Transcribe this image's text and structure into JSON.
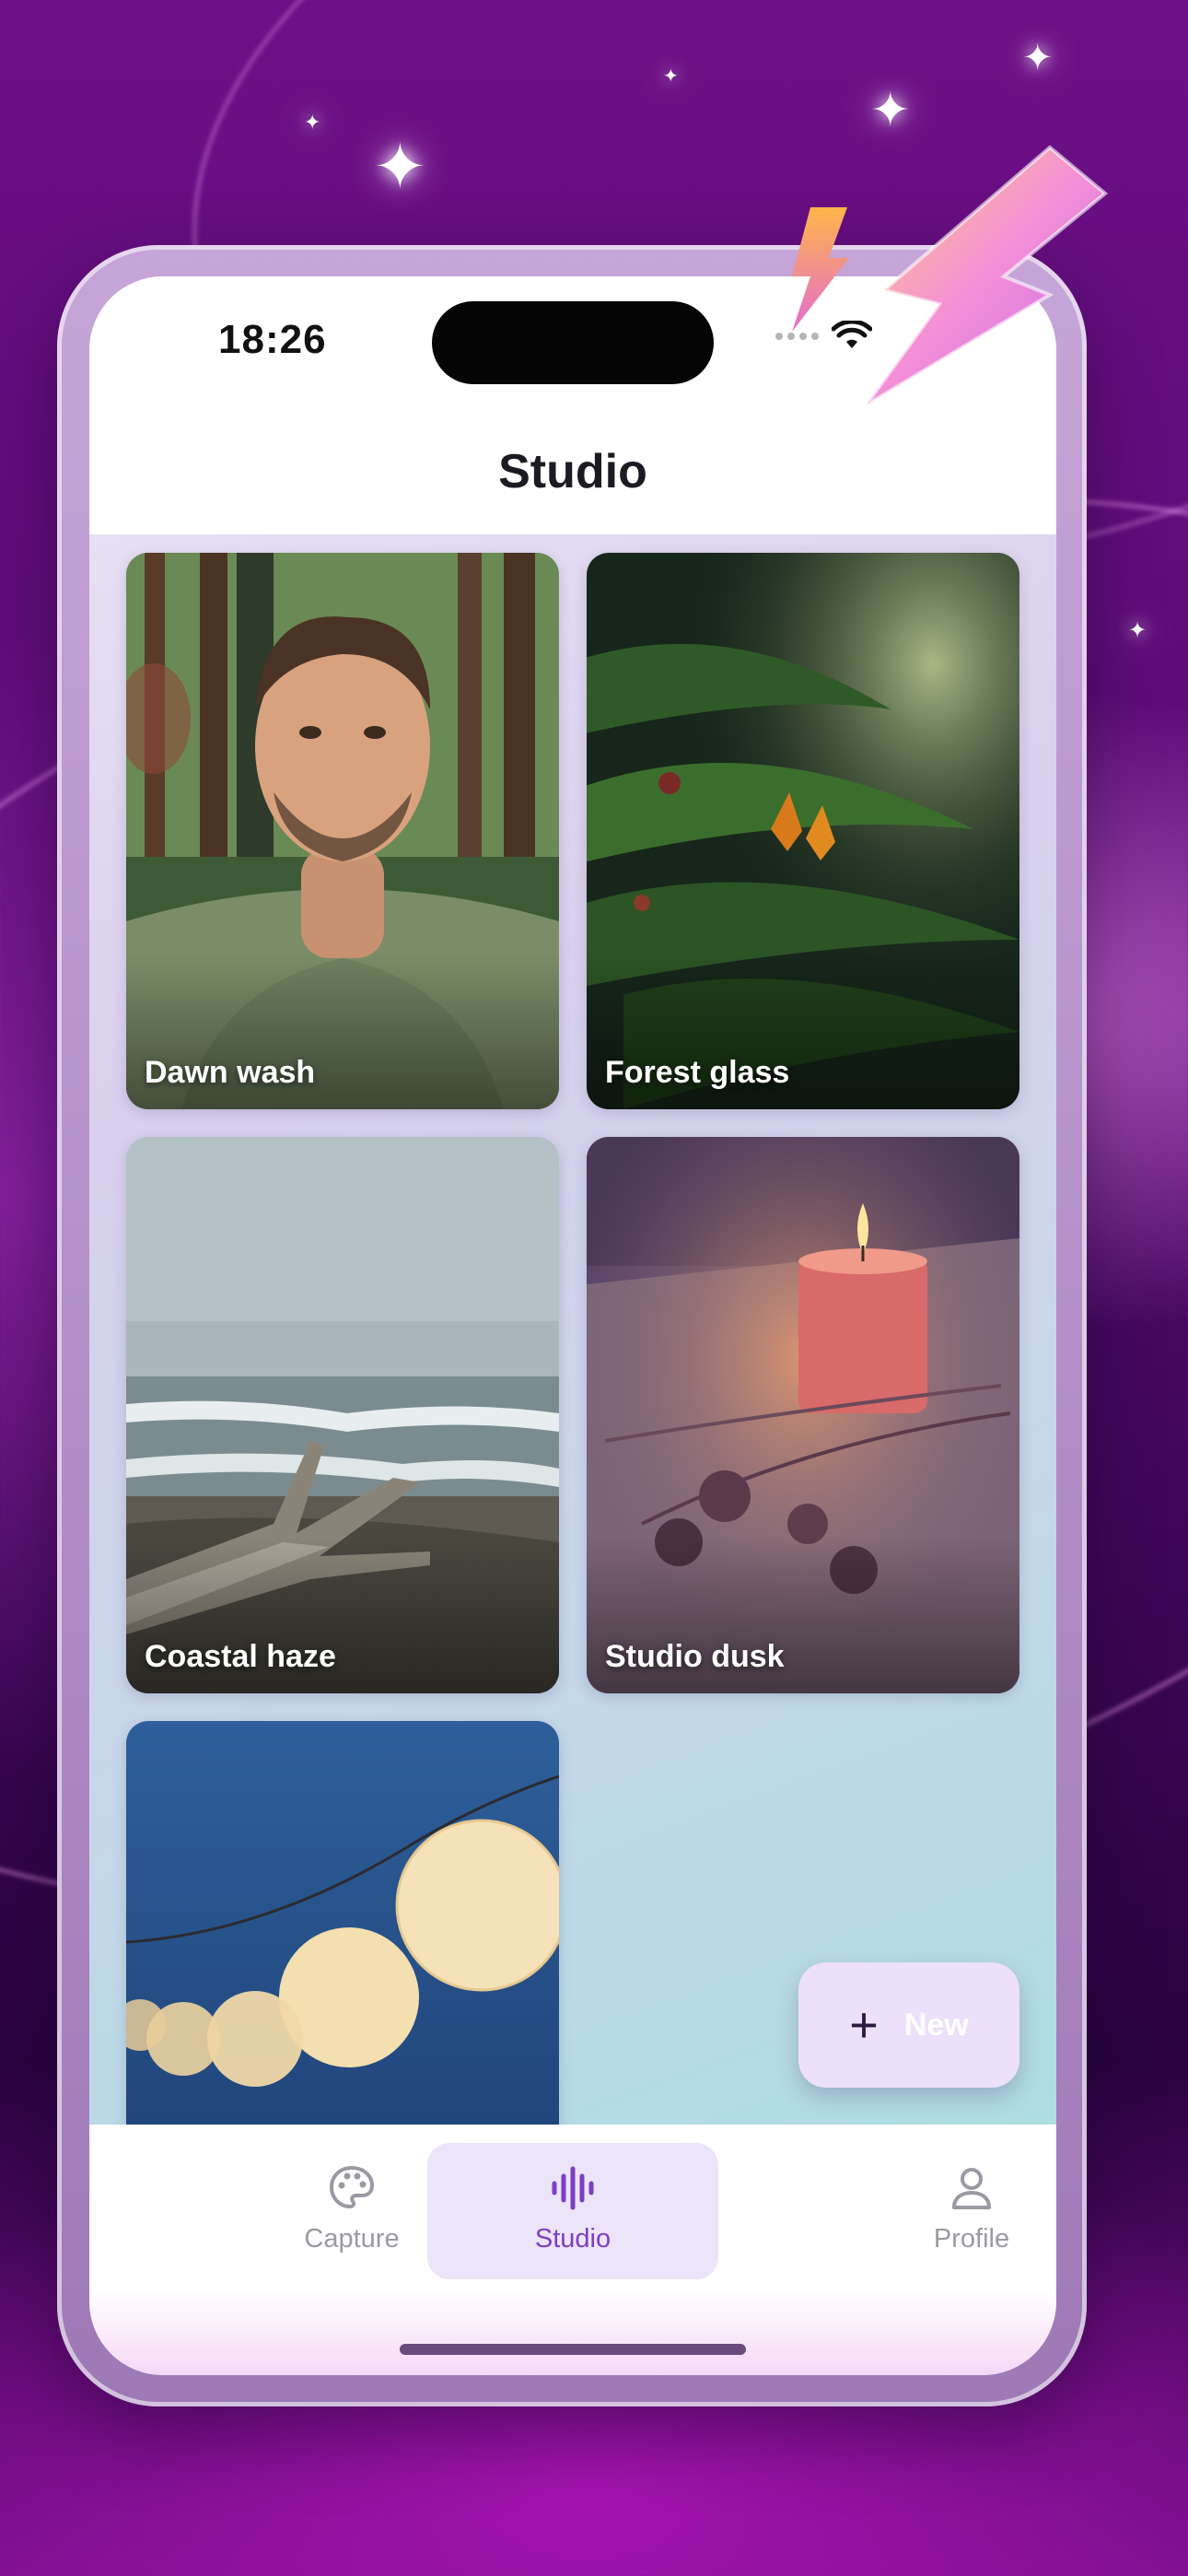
{
  "status_bar": {
    "time": "18:26"
  },
  "header": {
    "title": "Studio"
  },
  "gallery": [
    {
      "caption": "Dawn wash"
    },
    {
      "caption": "Forest glass"
    },
    {
      "caption": "Coastal haze"
    },
    {
      "caption": "Studio dusk"
    },
    {
      "caption": ""
    }
  ],
  "fab": {
    "icon": "plus-icon",
    "label": "New"
  },
  "tabs": [
    {
      "label": "Capture",
      "icon": "palette-icon",
      "active": false
    },
    {
      "label": "Studio",
      "icon": "waveform-icon",
      "active": true
    },
    {
      "label": "Profile",
      "icon": "person-icon",
      "active": false
    }
  ],
  "colors": {
    "accent": "#7b3fc4",
    "active_tab_bg": "#ece4f8",
    "inactive": "#9a9aa2"
  }
}
